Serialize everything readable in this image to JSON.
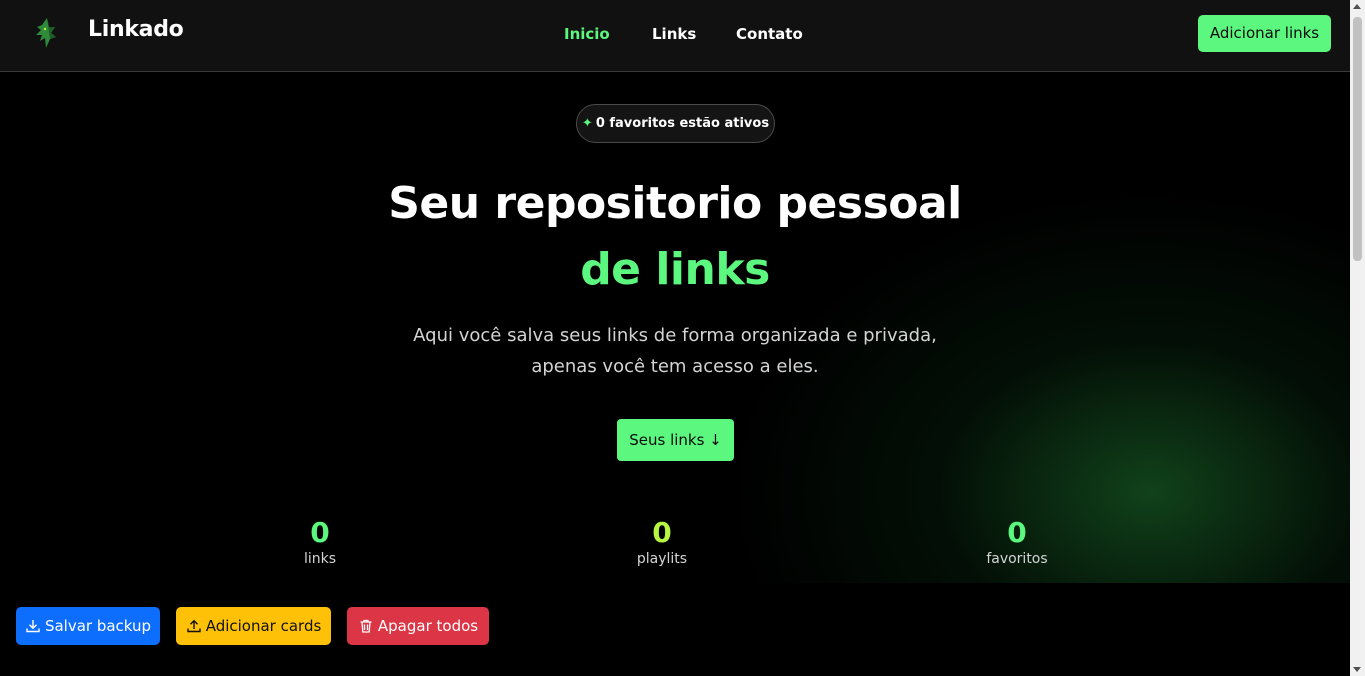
{
  "header": {
    "brand": "Linkado",
    "nav": [
      "Inicio",
      "Links",
      "Contato"
    ],
    "add_links_label": "Adicionar links"
  },
  "hero": {
    "badge": "0 favoritos estão ativos",
    "title_line1": "Seu repositorio pessoal",
    "title_line2": "de links",
    "subtitle_line1": "Aqui você salva seus links de forma organizada e privada,",
    "subtitle_line2": "apenas você tem acesso a eles.",
    "cta_label": "Seus links ↓"
  },
  "stats": [
    {
      "value": "0",
      "label": "links"
    },
    {
      "value": "0",
      "label": "playlits"
    },
    {
      "value": "0",
      "label": "favoritos"
    }
  ],
  "actions": {
    "backup_label": "Salvar backup",
    "add_cards_label": "Adicionar cards",
    "delete_all_label": "Apagar todos"
  },
  "colors": {
    "accent": "#5cf77e",
    "stat_playlists": "#b6f542",
    "backup": "#0d6efd",
    "add_cards": "#ffc107",
    "delete_all": "#dc3545"
  },
  "icons": {
    "logo": "wolf-head-logo-icon",
    "badge": "sparkles-icon",
    "backup": "download-icon",
    "add_cards": "upload-icon",
    "delete_all": "trash-icon"
  }
}
